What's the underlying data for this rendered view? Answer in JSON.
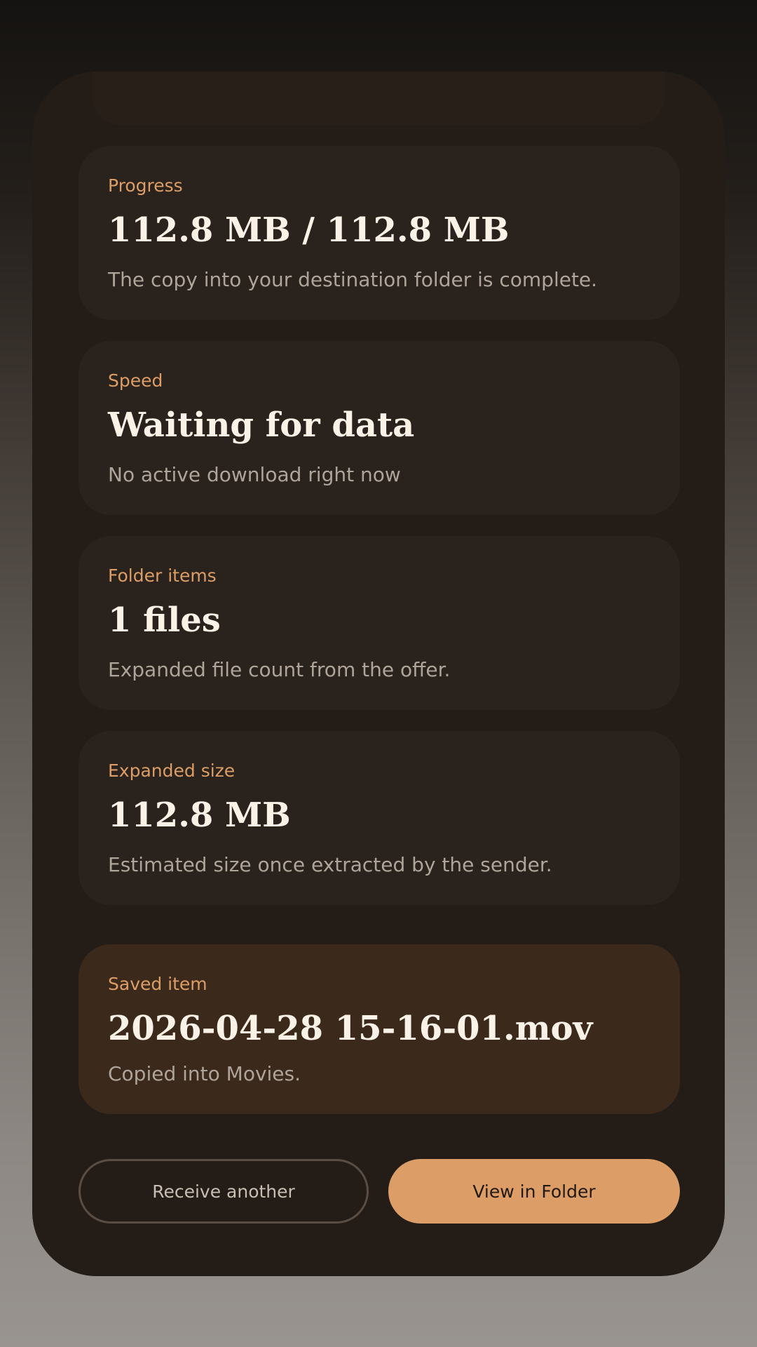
{
  "cards": [
    {
      "label": "Progress",
      "value": "112.8 MB / 112.8 MB",
      "description": "The copy into your destination folder is complete."
    },
    {
      "label": "Speed",
      "value": "Waiting for data",
      "description": "No active download right now"
    },
    {
      "label": "Folder items",
      "value": "1 files",
      "description": "Expanded file count from the offer."
    },
    {
      "label": "Expanded size",
      "value": "112.8 MB",
      "description": "Estimated size once extracted by the sender."
    }
  ],
  "saved": {
    "label": "Saved item",
    "value": "2026-04-28 15-16-01.mov",
    "description": "Copied into Movies."
  },
  "actions": {
    "secondary_label": "Receive another",
    "primary_label": "View in Folder"
  },
  "colors": {
    "accent": "#dc9d66",
    "sheet": "#231c17",
    "card": "#2a221c",
    "card_highlight": "#3b291b",
    "value_text": "#fbf2e7"
  }
}
